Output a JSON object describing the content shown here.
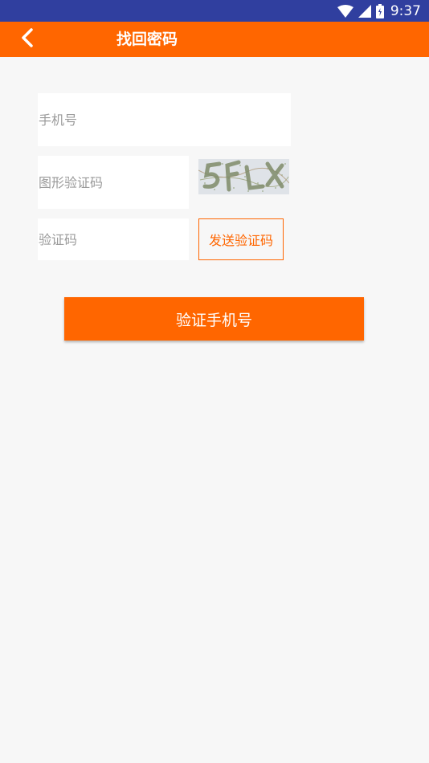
{
  "status_bar": {
    "time": "9:37",
    "icons": [
      "wifi-icon",
      "signal-icon",
      "battery-icon"
    ]
  },
  "app_bar": {
    "title": "找回密码",
    "back_icon": "chevron-left-icon"
  },
  "form": {
    "phone_placeholder": "手机号",
    "captcha_placeholder": "图形验证码",
    "captcha_image_text": "5FLX",
    "code_placeholder": "验证码",
    "send_code_label": "发送验证码",
    "submit_label": "验证手机号"
  },
  "colors": {
    "primary": "#ff6600",
    "status_bar": "#303f9f",
    "background": "#f7f7f7"
  }
}
